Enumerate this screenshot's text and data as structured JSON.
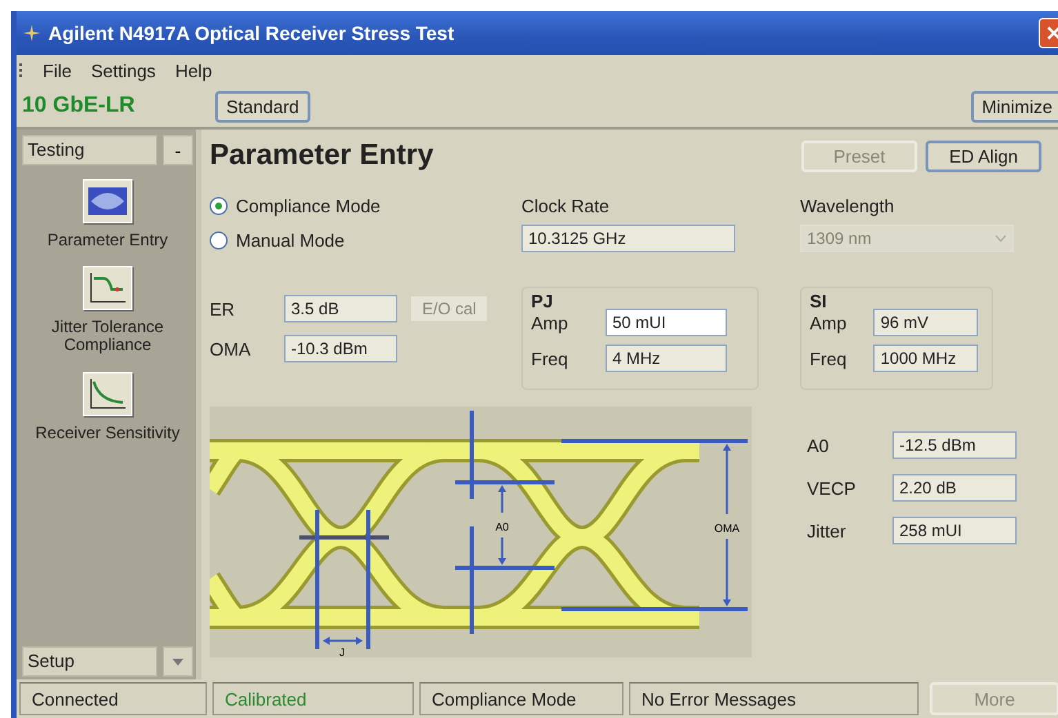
{
  "window": {
    "title": "Agilent N4917A Optical Receiver Stress Test"
  },
  "menu": [
    "File",
    "Settings",
    "Help"
  ],
  "standard": {
    "name": "10 GbE-LR",
    "button": "Standard"
  },
  "minimize_button": "Minimize",
  "sidebar": {
    "header": "Testing",
    "collapse": "-",
    "footer": "Setup",
    "items": [
      {
        "label": "Parameter Entry",
        "kind": "eye"
      },
      {
        "label": "Jitter Tolerance Compliance",
        "kind": "jitter"
      },
      {
        "label": "Receiver Sensitivity",
        "kind": "sensitivity"
      }
    ]
  },
  "page": {
    "title": "Parameter Entry",
    "buttons": [
      {
        "label": "Preset",
        "disabled": true
      },
      {
        "label": "ED Align",
        "disabled": false
      }
    ]
  },
  "modes": [
    {
      "label": "Compliance Mode",
      "selected": true
    },
    {
      "label": "Manual Mode",
      "selected": false
    }
  ],
  "clock_rate": {
    "label": "Clock Rate",
    "value": "10.3125 GHz"
  },
  "wavelength": {
    "label": "Wavelength",
    "value": "1309 nm",
    "disabled": true
  },
  "er": {
    "label": "ER",
    "value": "3.5 dB"
  },
  "eo_cal": {
    "label": "E/O cal",
    "disabled": true
  },
  "oma": {
    "label": "OMA",
    "value": "-10.3 dBm"
  },
  "pj": {
    "title": "PJ",
    "fields": [
      {
        "label": "Amp",
        "value": "50 mUI",
        "editable": true
      },
      {
        "label": "Freq",
        "value": "4 MHz",
        "editable": false
      }
    ]
  },
  "si": {
    "title": "SI",
    "fields": [
      {
        "label": "Amp",
        "value": "96 mV",
        "editable": false
      },
      {
        "label": "Freq",
        "value": "1000 MHz",
        "editable": false
      }
    ]
  },
  "diagram": {
    "labels": [
      "A0",
      "OMA",
      "J"
    ]
  },
  "results": [
    {
      "label": "A0",
      "value": "-12.5 dBm"
    },
    {
      "label": "VECP",
      "value": "2.20 dB"
    },
    {
      "label": "Jitter",
      "value": "258 mUI"
    }
  ],
  "status_bar": {
    "items": [
      {
        "text": "Connected",
        "kind": "plain"
      },
      {
        "text": "Calibrated",
        "kind": "ok"
      },
      {
        "text": "Compliance Mode",
        "kind": "plain"
      },
      {
        "text": "No Error Messages",
        "kind": "plain"
      }
    ],
    "more": {
      "label": "More",
      "disabled": true
    }
  }
}
